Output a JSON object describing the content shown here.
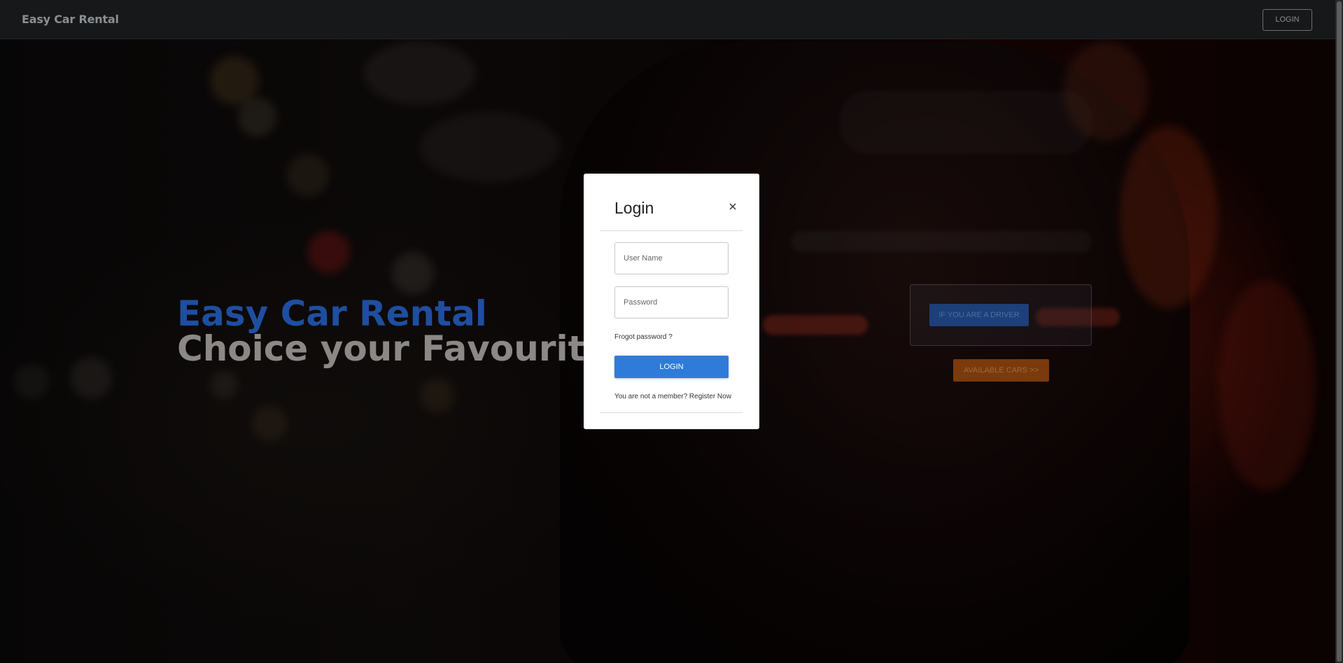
{
  "navbar": {
    "brand": "Easy Car Rental",
    "login_label": "LOGIN"
  },
  "hero": {
    "title": "Easy Car Rental",
    "subtitle": "Choice your Favourite"
  },
  "actions": {
    "driver_label": "IF YOU ARE A DRIVER",
    "cars_label": "AVAILABLE CARS >>"
  },
  "login_modal": {
    "title": "Login",
    "username_placeholder": "User Name",
    "password_placeholder": "Password",
    "forgot_label": "Frogot password ?",
    "submit_label": "LOGIN",
    "register_text": "You are not a member? Register Now"
  },
  "icons": {
    "close": "close-icon"
  },
  "colors": {
    "hero_title": "#1f4ea0",
    "hero_subtitle": "#8b8886",
    "login_button": "#2f7bd9",
    "driver_button": "#1d3f7a",
    "cars_button": "#7a3a0c"
  }
}
